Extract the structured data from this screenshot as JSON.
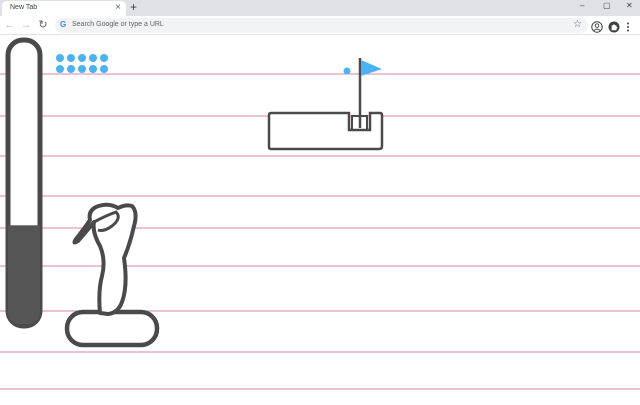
{
  "browser": {
    "tab_title": "New Tab",
    "tab_close": "×",
    "new_tab": "+",
    "omnibox_placeholder": "Search Google or type a URL",
    "window_controls": [
      "–",
      "▢",
      "✕"
    ]
  },
  "game": {
    "colors": {
      "paper_line": "#cc6699",
      "outline": "#4a4a4a",
      "power_fill": "#555555",
      "flag": "#4ab3f4",
      "ball": "#4ab3f4"
    },
    "power_level": 0.35,
    "balls_remaining": 10,
    "ball_in_flight": true,
    "icons": {
      "golfer": "golfer-icon",
      "flag": "flag-icon",
      "hole": "hole-icon"
    }
  }
}
